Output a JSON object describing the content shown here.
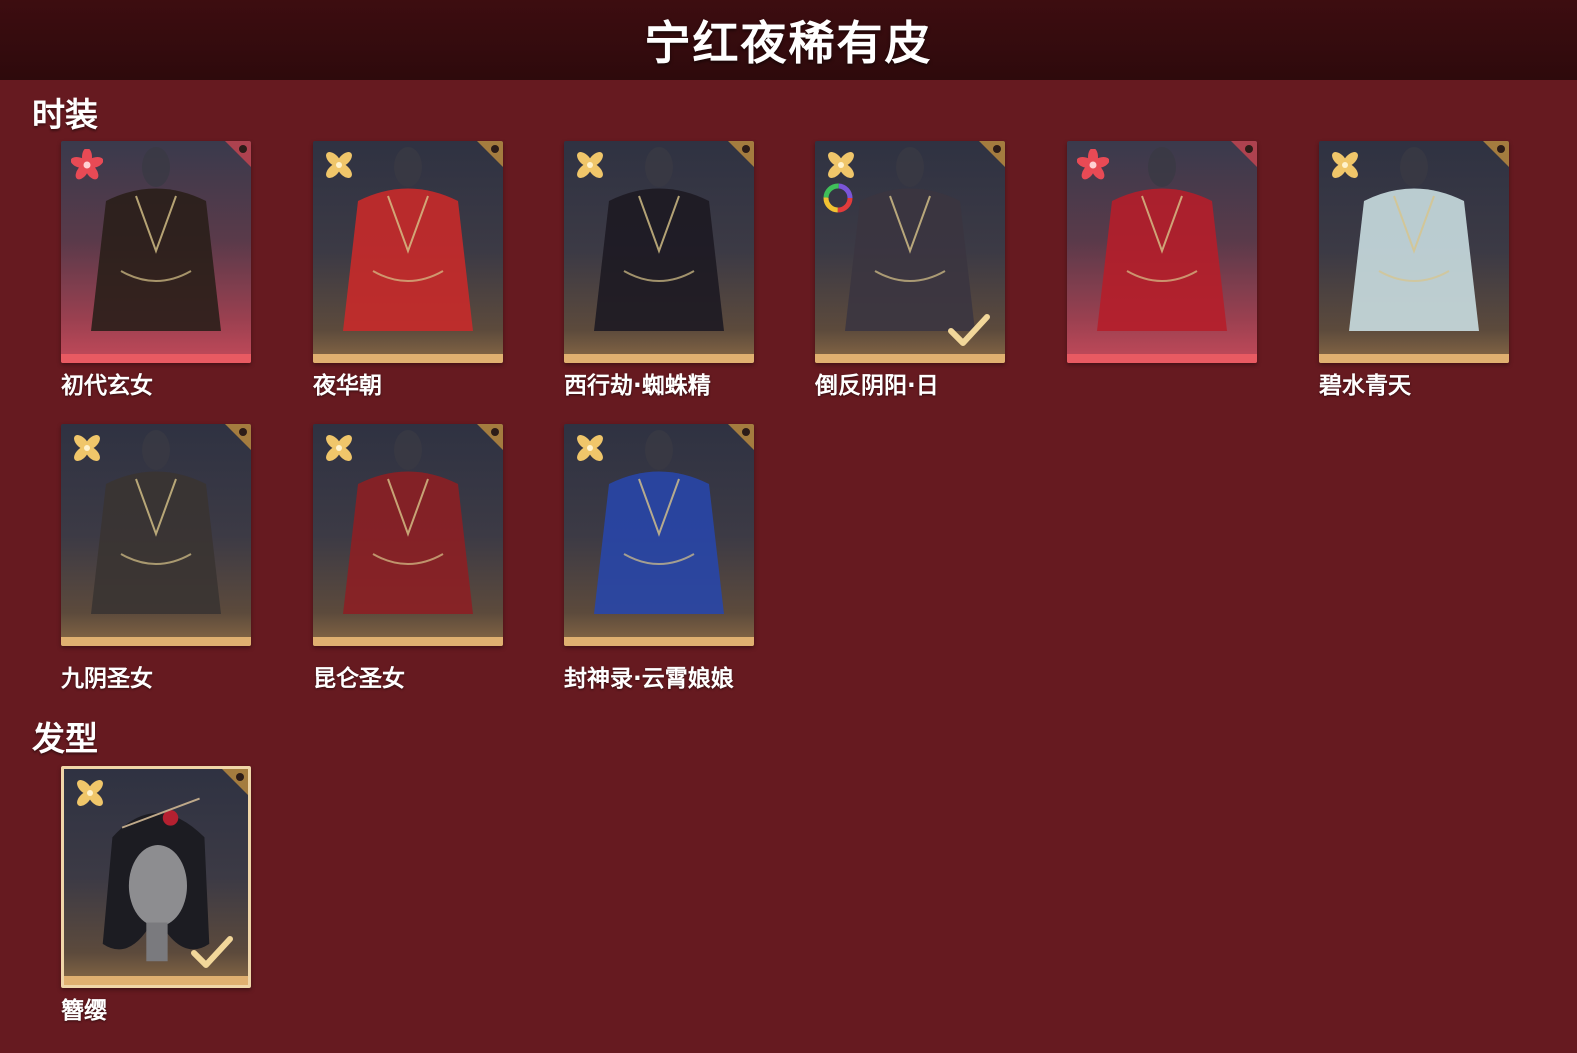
{
  "header": {
    "title": "宁红夜稀有皮"
  },
  "sections": {
    "outfits_title": "时装",
    "hair_title": "发型"
  },
  "outfits": [
    {
      "name": "初代玄女",
      "rarity": "red"
    },
    {
      "name": "夜华朝",
      "rarity": "gold"
    },
    {
      "name": "西行劫·蜘蛛精",
      "rarity": "gold"
    },
    {
      "name": "倒反阴阳·日",
      "rarity": "gold",
      "dye": true,
      "equipped": true
    },
    {
      "name": "",
      "rarity": "red"
    },
    {
      "name": "碧水青天",
      "rarity": "gold"
    },
    {
      "name": "九阴圣女",
      "rarity": "gold"
    },
    {
      "name": "昆仑圣女",
      "rarity": "gold"
    },
    {
      "name": "封神录·云霄娘娘",
      "rarity": "gold"
    }
  ],
  "hair": [
    {
      "name": "簪缨",
      "rarity": "gold",
      "equipped": true
    }
  ],
  "colors": {
    "background": "#661a20",
    "header": "#2e0a0c",
    "gold_accent": "#e0b070",
    "red_accent": "#e85a62"
  },
  "icons": {
    "gold_rarity": "four-petal-flower-icon",
    "red_rarity": "five-petal-flower-icon",
    "dye": "color-wheel-icon",
    "equipped": "checkmark-icon"
  }
}
